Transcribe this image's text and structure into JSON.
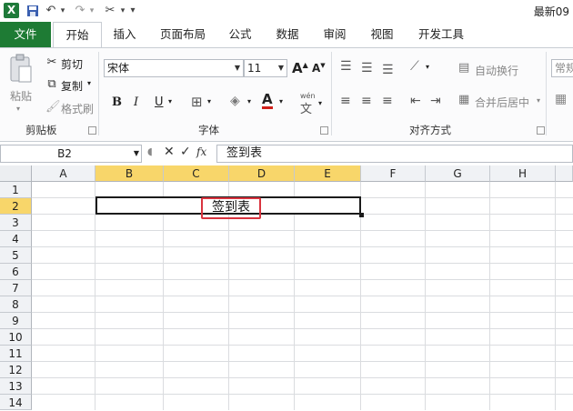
{
  "title_bar": {
    "title": "最新09"
  },
  "quick_access": {
    "save": "H",
    "undo": "↶",
    "redo": "↷",
    "customize": "▾"
  },
  "tabs": {
    "file": "文件",
    "items": [
      "开始",
      "插入",
      "页面布局",
      "公式",
      "数据",
      "审阅",
      "视图",
      "开发工具"
    ]
  },
  "ribbon": {
    "clipboard": {
      "label": "剪贴板",
      "paste": "粘贴",
      "cut": "剪切",
      "copy": "复制",
      "format_painter": "格式刷"
    },
    "font": {
      "label": "字体",
      "font_name": "宋体",
      "font_size": "11",
      "bold": "B",
      "italic": "I",
      "underline": "U",
      "font_color_glyph": "A",
      "phonetic": "wén"
    },
    "alignment": {
      "label": "对齐方式",
      "wrap_text": "自动换行",
      "merge_center": "合并后居中"
    },
    "number": {
      "format": "常规"
    }
  },
  "formula_bar": {
    "name_box": "B2",
    "fx": "fx",
    "content": "签到表"
  },
  "grid": {
    "columns": [
      "A",
      "B",
      "C",
      "D",
      "E",
      "F",
      "G",
      "H"
    ],
    "rows": [
      "1",
      "2",
      "3",
      "4",
      "5",
      "6",
      "7",
      "8",
      "9",
      "10",
      "11",
      "12",
      "13",
      "14"
    ],
    "cell_text": "签到表"
  },
  "colors": {
    "file_tab": "#1e7b34",
    "selected_header": "#f8d66a",
    "highlight_box": "#d9343f"
  }
}
